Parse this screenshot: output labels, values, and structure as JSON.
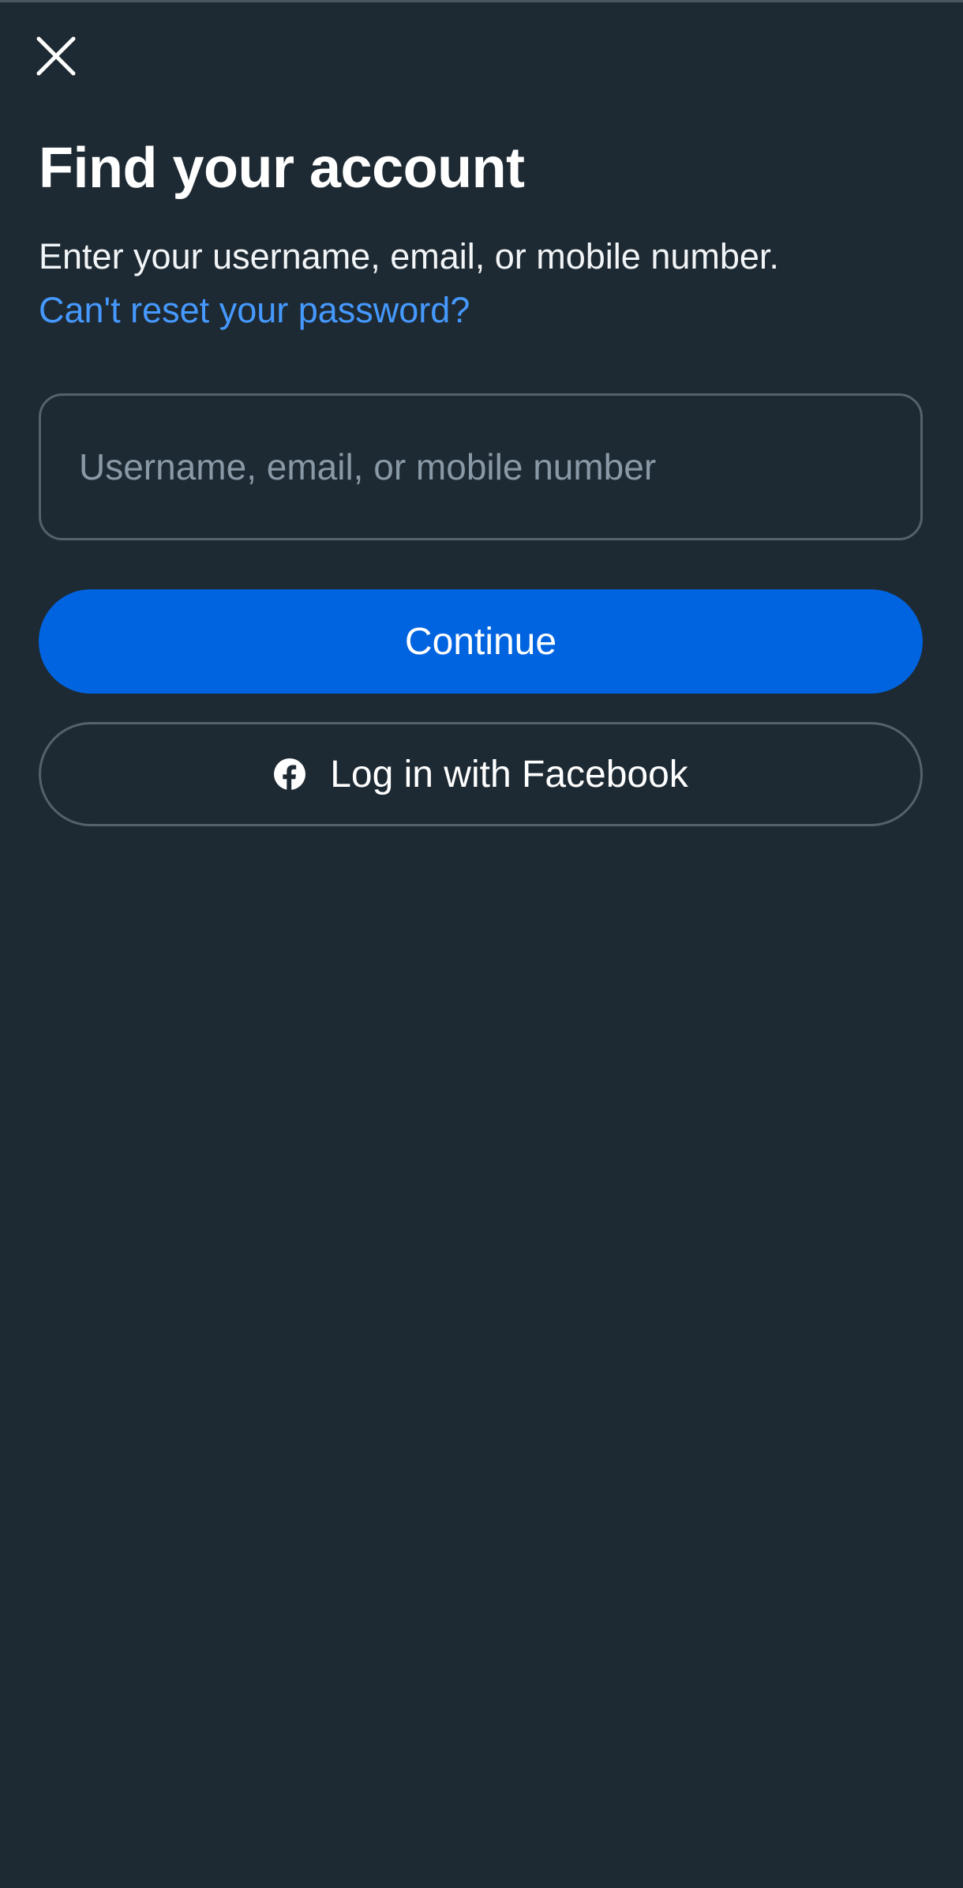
{
  "header": {
    "close_icon": "close-icon"
  },
  "main": {
    "title": "Find your account",
    "subtitle": "Enter your username, email, or mobile number.",
    "reset_link": "Can't reset your password?",
    "input": {
      "placeholder": "Username, email, or mobile number",
      "value": ""
    },
    "continue_label": "Continue",
    "facebook": {
      "label": "Log in with Facebook",
      "icon": "facebook-icon"
    }
  },
  "colors": {
    "background": "#1e2a33",
    "accent": "#0064e0",
    "link": "#4599ff",
    "border": "#55616b",
    "placeholder": "#8a99a6"
  }
}
